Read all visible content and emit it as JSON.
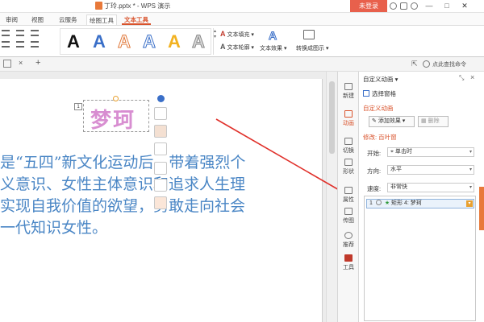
{
  "window": {
    "doc_title": "丁玲.pptx * - WPS 演示",
    "login_label": "未登录",
    "min": "—",
    "max": "□",
    "close": "✕"
  },
  "tabs": [
    {
      "label": "审阅"
    },
    {
      "label": "视图"
    },
    {
      "label": "云服务"
    },
    {
      "label": "绘图工具"
    },
    {
      "label": "文本工具"
    }
  ],
  "ribbon": {
    "text_fill": "文本填充",
    "text_outline": "文本轮廓",
    "text_effect": "文本效果",
    "convert_to_art": "转换成图示",
    "quick_label": "未同步",
    "find_cmd": "点此查找命令"
  },
  "slide": {
    "wordart": "梦珂",
    "anim_tag": "1",
    "lines": [
      "是“五四”新文化运动后，带着强烈个",
      "义意识、女性主体意识和追求人生理",
      "实现自我价值的欲望，勇敢走向社会",
      "一代知识女性。"
    ]
  },
  "side_tools": [
    {
      "label": "新建",
      "icon": "new-icon"
    },
    {
      "label": "动画",
      "icon": "animation-icon"
    },
    {
      "label": "切换",
      "icon": "transition-icon"
    },
    {
      "label": "形状",
      "icon": "shape-icon"
    },
    {
      "label": "属性",
      "icon": "property-icon"
    },
    {
      "label": "传图",
      "icon": "upload-image-icon"
    },
    {
      "label": "推荐",
      "icon": "recommend-icon"
    },
    {
      "label": "工具",
      "icon": "toolbox-icon"
    }
  ],
  "panel": {
    "title": "自定义动画",
    "select_pane": "选择窗格",
    "section_title": "自定义动画",
    "add_effect": "添加效果",
    "delete": "删除",
    "modify_label": "修改: 百叶窗",
    "start_label": "开始:",
    "start_value": "单击时",
    "direction_label": "方向:",
    "direction_value": "水平",
    "speed_label": "速度:",
    "speed_value": "非常快",
    "list_item_num": "1",
    "list_item_text": "矩形 4: 梦珂"
  },
  "colors": {
    "accent": "#d9532c",
    "arrow": "#e0302a",
    "body_text": "#4a86c5"
  }
}
